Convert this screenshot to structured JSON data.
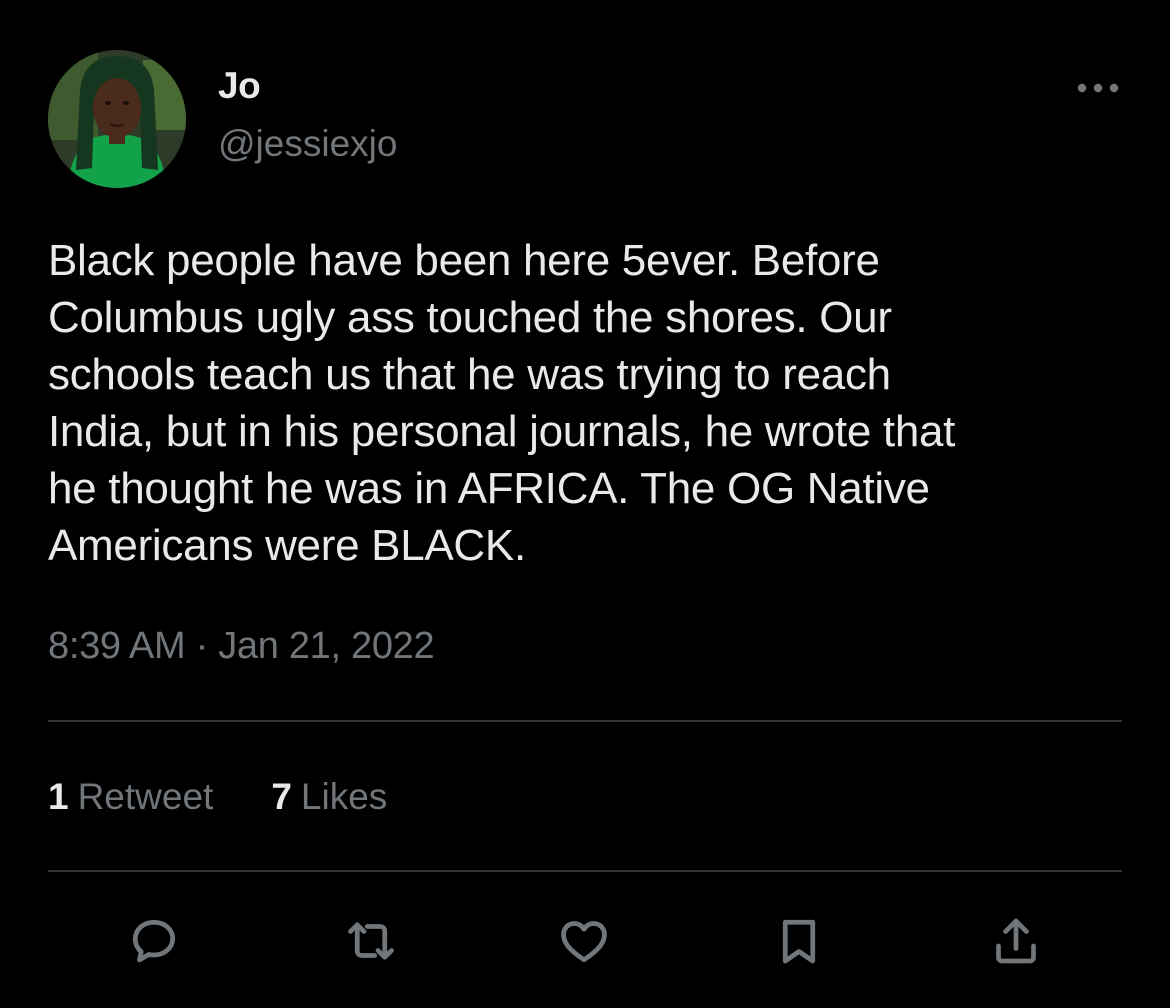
{
  "author": {
    "display_name": "Jo",
    "handle": "@jessiexjo",
    "avatar_icon": "profile-photo"
  },
  "tweet": {
    "text": "Black people have been here 5ever. Before\nColumbus ugly ass touched the shores. Our\nschools teach us that he was trying to reach\nIndia, but in his personal journals, he wrote that\nhe thought he was in AFRICA. The OG Native\nAmericans were BLACK.",
    "timestamp": "8:39 AM · Jan 21, 2022"
  },
  "stats": {
    "retweets_count": "1",
    "retweets_label": "Retweet",
    "likes_count": "7",
    "likes_label": "Likes"
  },
  "actions": [
    {
      "name": "reply",
      "icon": "speech-bubble-icon"
    },
    {
      "name": "retweet",
      "icon": "retweet-arrows-icon"
    },
    {
      "name": "like",
      "icon": "heart-icon"
    },
    {
      "name": "bookmark",
      "icon": "bookmark-icon"
    },
    {
      "name": "share",
      "icon": "share-upload-icon"
    }
  ],
  "colors": {
    "background": "#000000",
    "primary_text": "#e7e9ea",
    "secondary_text": "#71767b",
    "divider": "#2f3336"
  }
}
